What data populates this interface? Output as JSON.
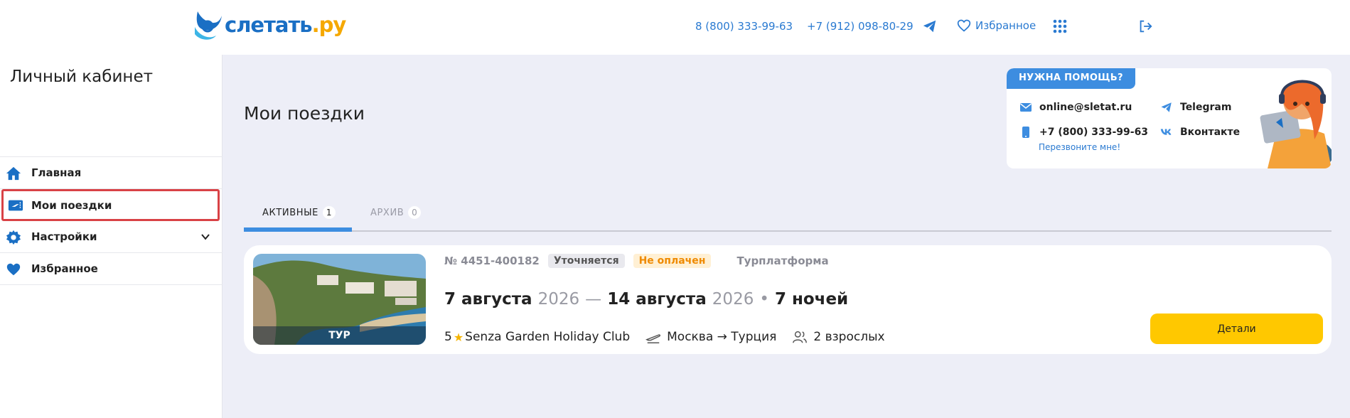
{
  "header": {
    "logo_main": "слетать",
    "logo_suffix": ".ру",
    "phone1": "8 (800) 333-99-63",
    "phone2": "+7 (912) 098-80-29",
    "favorites_label": "Избранное",
    "icons": [
      "telegram-icon",
      "heart-icon",
      "apps-grid-icon",
      "logout-icon"
    ]
  },
  "sidebar": {
    "title": "Личный кабинет",
    "items": [
      {
        "label": "Главная",
        "icon": "home-icon"
      },
      {
        "label": "Мои поездки",
        "icon": "ticket-icon",
        "active": true
      },
      {
        "label": "Настройки",
        "icon": "gear-icon"
      },
      {
        "label": "Избранное",
        "icon": "heart-icon"
      }
    ]
  },
  "main": {
    "title": "Мои поездки",
    "help": {
      "badge": "НУЖНА ПОМОЩЬ?",
      "email": "online@sletat.ru",
      "telegram": "Telegram",
      "phone": "+7 (800) 333-99-63",
      "vk": "Вконтакте",
      "callback": "Перезвоните мне!"
    },
    "tabs": [
      {
        "label": "АКТИВНЫЕ",
        "count": "1",
        "active": true
      },
      {
        "label": "АРХИВ",
        "count": "0",
        "active": false
      }
    ],
    "trip": {
      "photo_label": "ТУР",
      "order_number": "№ 4451-400182",
      "status1": "Уточняется",
      "status2": "Не оплачен",
      "platform": "Турплатформа",
      "date_from_day": "7 августа",
      "date_from_year": "2026",
      "dash": "—",
      "date_to_day": "14 августа",
      "date_to_year": "2026",
      "bullet": "•",
      "nights": "7 ночей",
      "stars": "5",
      "hotel": "Senza Garden Holiday Club",
      "route": "Москва → Турция",
      "tourists": "2 взрослых",
      "details_button": "Детали"
    }
  },
  "colors": {
    "accent_blue": "#3d8de0",
    "link_blue": "#2a7ad1",
    "button_yellow": "#ffc800",
    "status_orange": "#ef8a00",
    "active_outline": "#d94246",
    "background": "#edeef7"
  }
}
